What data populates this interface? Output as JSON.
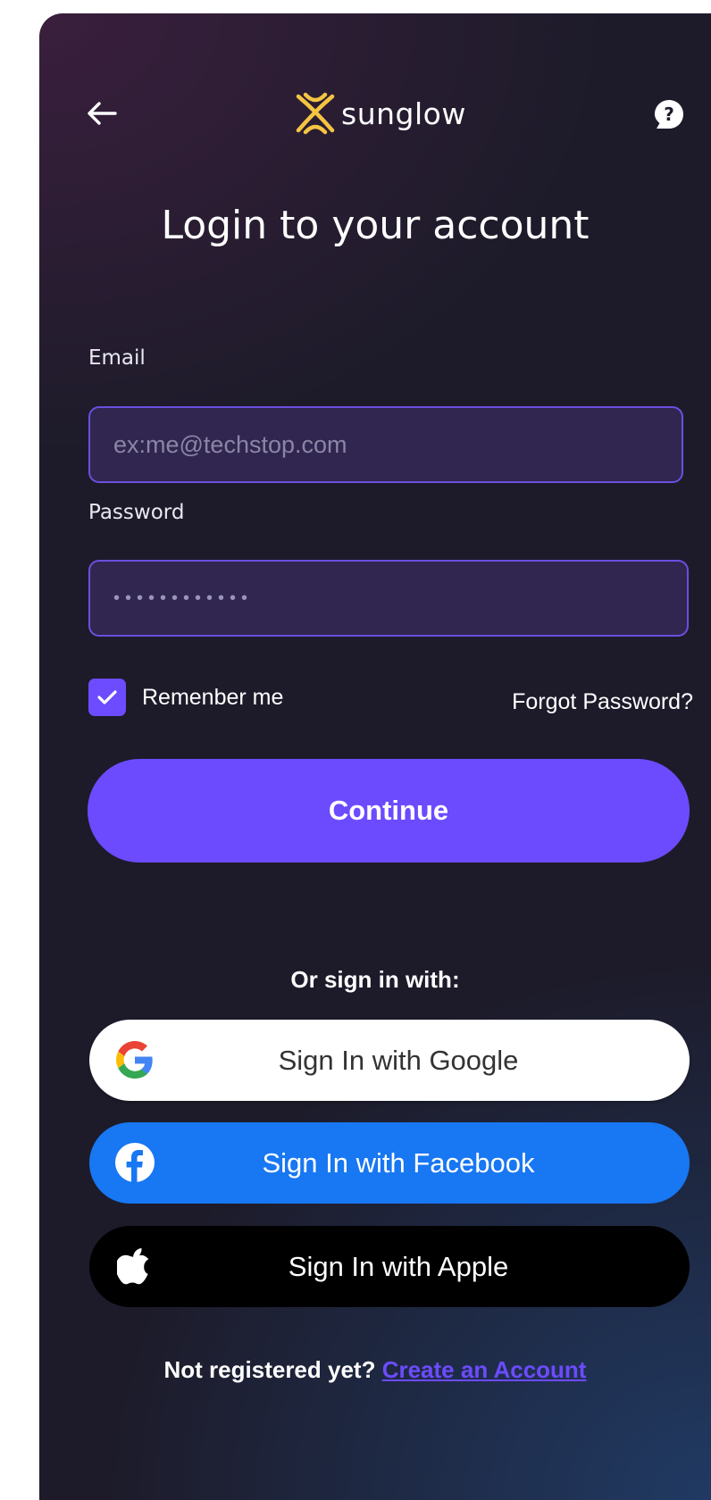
{
  "brand": {
    "name": "sunglow",
    "logo_color": "#f5c542"
  },
  "page": {
    "title": "Login to your account"
  },
  "form": {
    "email_label": "Email",
    "email_placeholder": "ex:me@techstop.com",
    "email_value": "",
    "password_label": "Password",
    "password_value": "••••••••••••",
    "remember_label": "Remenber me",
    "remember_checked": true,
    "forgot_label": "Forgot Password?",
    "continue_label": "Continue"
  },
  "social": {
    "heading": "Or sign in with:",
    "google_label": "Sign In with Google",
    "facebook_label": "Sign In with Facebook",
    "apple_label": "Sign In with Apple"
  },
  "footer": {
    "prompt": "Not registered yet?",
    "link_label": "Create an Account"
  },
  "icons": {
    "back": "arrow-left-icon",
    "help": "help-chat-icon",
    "check": "check-icon",
    "google": "google-icon",
    "facebook": "facebook-icon",
    "apple": "apple-icon"
  },
  "colors": {
    "accent": "#6c4bff",
    "facebook": "#1877f2",
    "apple": "#000000",
    "input_bg": "#302650",
    "input_border": "#6b4fe0"
  }
}
